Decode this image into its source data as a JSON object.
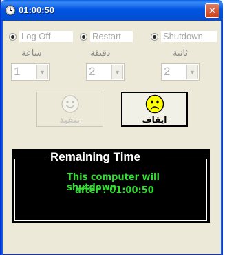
{
  "window": {
    "title": "01:00:50",
    "close_glyph": "✕",
    "app_icon": "clock-icon"
  },
  "modes": [
    {
      "label": "Log Off",
      "selected": false
    },
    {
      "label": "Restart",
      "selected": false
    },
    {
      "label": "Shutdown",
      "selected": false
    }
  ],
  "fields": {
    "hours": {
      "label": "ساعة",
      "value": "1"
    },
    "minutes": {
      "label": "دقيقة",
      "value": "2"
    },
    "seconds": {
      "label": "ثانية",
      "value": "2"
    }
  },
  "buttons": {
    "execute": {
      "label": "تنفيذ",
      "icon": "smiley-face-icon",
      "enabled": false
    },
    "stop": {
      "label": "ايقاف",
      "icon": "sad-face-icon",
      "enabled": true
    }
  },
  "panel": {
    "title": "Remaining Time",
    "line1": "This computer will shutdown",
    "line2": "after : 01:00:50"
  },
  "colors": {
    "titlebar": "#0054e3",
    "panel_bg": "#000000",
    "status_text": "#33dd33",
    "sad_face": "#ffff00"
  }
}
